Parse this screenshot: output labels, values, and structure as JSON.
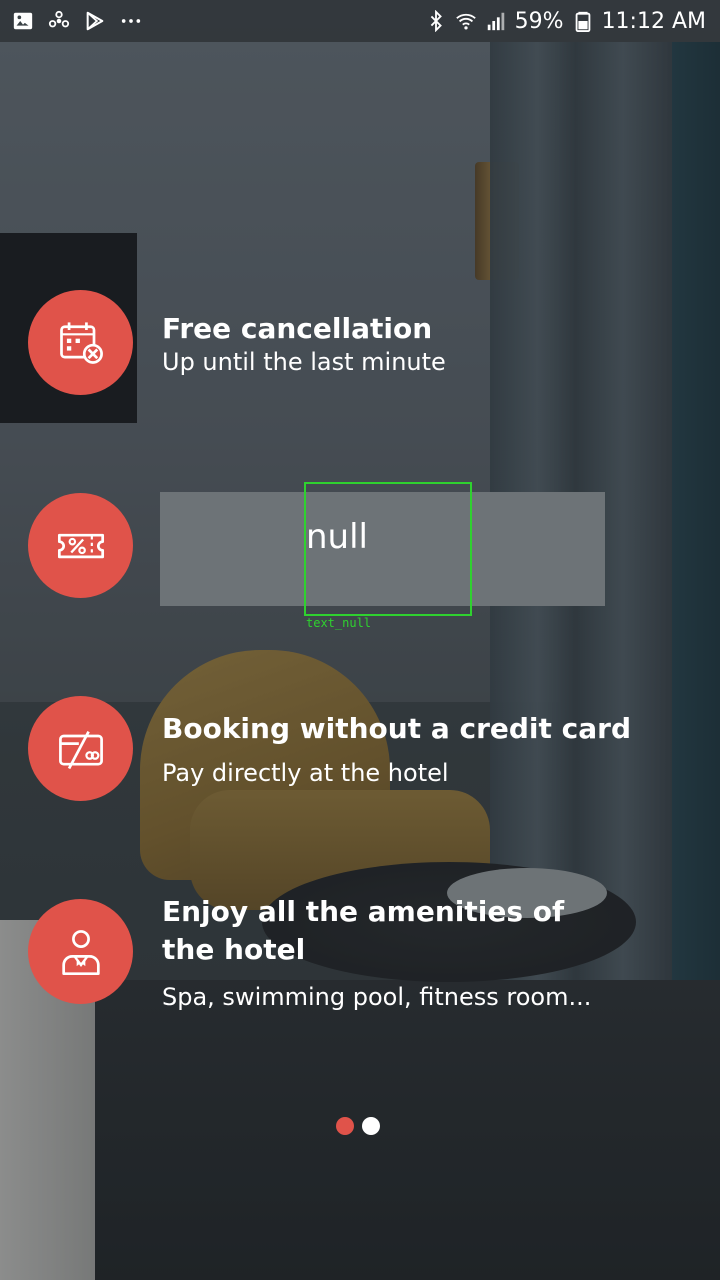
{
  "status_bar": {
    "left_icons": [
      "image-icon",
      "fan-icon",
      "play-store-icon",
      "more-dots-icon"
    ],
    "battery": "59%",
    "time": "11:12 AM",
    "right_icons": [
      "bluetooth-icon",
      "wifi-icon",
      "signal-icon",
      "battery-icon"
    ]
  },
  "features": [
    {
      "icon": "calendar-cancel-icon",
      "title": "Free cancellation",
      "subtitle": "Up until the last minute"
    },
    {
      "icon": "discount-ticket-icon",
      "placeholder": "null",
      "debug_label": "text_null"
    },
    {
      "icon": "no-credit-card-icon",
      "title": "Booking without a credit card",
      "subtitle": "Pay directly at the hotel"
    },
    {
      "icon": "concierge-icon",
      "title_line1": "Enjoy all the amenities of",
      "title_line2": "the hotel",
      "subtitle": "Spa, swimming pool, fitness room..."
    }
  ],
  "pager": {
    "page_count": 2,
    "active_index": 0
  },
  "colors": {
    "accent": "#e0534a",
    "text": "#ffffff",
    "pager_active": "#e0534a",
    "pager_inactive": "#ffffff",
    "debug": "#2fd12f"
  }
}
